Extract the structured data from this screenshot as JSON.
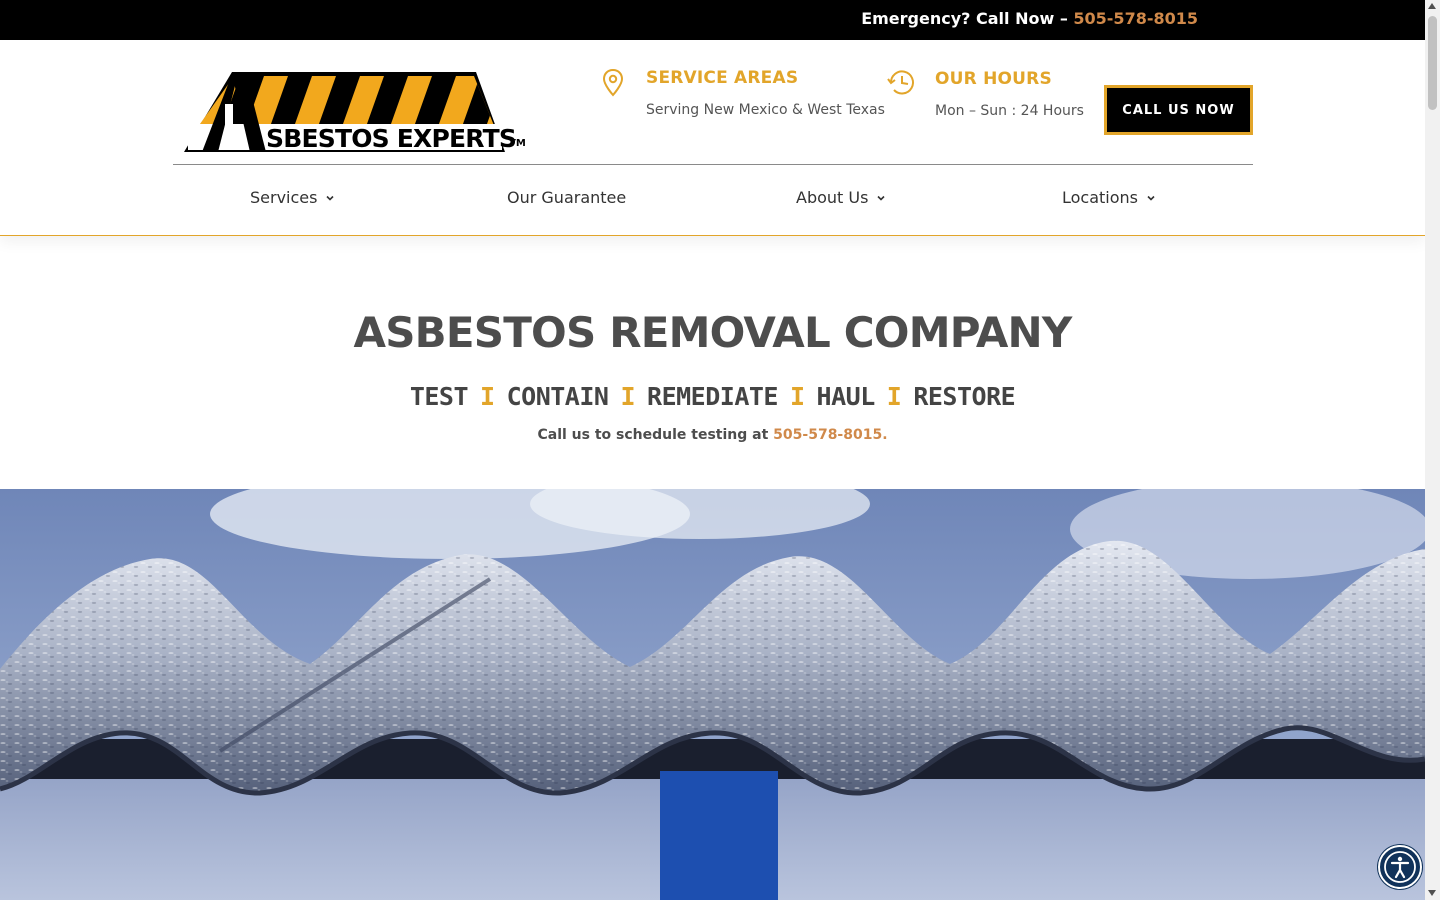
{
  "topbar": {
    "emergency_text": "Emergency? Call Now – ",
    "phone": "505-578-8015"
  },
  "logo": {
    "brand_text": "SBESTOS EXPERTS",
    "trademark": "TM"
  },
  "service_areas": {
    "title": "SERVICE AREAS",
    "subtitle": "Serving New Mexico & West Texas",
    "icon": "map-pin-icon"
  },
  "hours": {
    "title": "OUR HOURS",
    "subtitle": "Mon – Sun : 24 Hours",
    "icon": "clock-history-icon"
  },
  "call_button": {
    "label": "CALL US NOW"
  },
  "nav": {
    "items": [
      {
        "label": "Services",
        "has_dropdown": true
      },
      {
        "label": "Our Guarantee",
        "has_dropdown": false
      },
      {
        "label": "About Us",
        "has_dropdown": true
      },
      {
        "label": "Locations",
        "has_dropdown": true
      }
    ]
  },
  "hero": {
    "title": "ASBESTOS REMOVAL COMPANY",
    "steps": [
      "TEST",
      "CONTAIN",
      "REMEDIATE",
      "HAUL",
      "RESTORE"
    ],
    "separator": "I",
    "schedule_text": "Call us to schedule testing at ",
    "schedule_phone": "505-578-8015."
  },
  "accessibility": {
    "icon": "accessibility-icon"
  },
  "colors": {
    "accent": "#e2a52a",
    "phone_link": "#d0894a",
    "topbar_bg": "#000000",
    "text_dark": "#4d4d4d"
  }
}
